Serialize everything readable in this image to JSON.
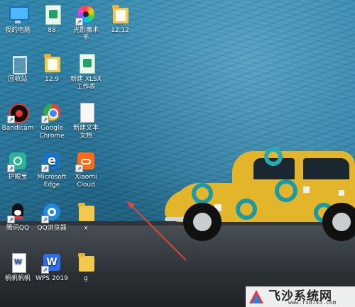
{
  "desktop": {
    "icons": [
      {
        "label": "我的电脑",
        "icon": "computer-icon"
      },
      {
        "label": "88",
        "icon": "spreadsheet-file-icon"
      },
      {
        "label": "光影魔术\n手",
        "icon": "color-wheel-icon"
      },
      {
        "label": "12.12",
        "icon": "folder-icon"
      },
      {
        "label": "回收站",
        "icon": "recycle-bin-icon"
      },
      {
        "label": "12.9",
        "icon": "folder-icon"
      },
      {
        "label": "新建 XLSX\n工作表",
        "icon": "spreadsheet-file-icon"
      },
      {
        "label": "Bandicam",
        "icon": "bandicam-icon"
      },
      {
        "label": "Google\nChrome",
        "icon": "chrome-icon"
      },
      {
        "label": "新建文本\n文档",
        "icon": "text-file-icon"
      },
      {
        "label": "护眼宝",
        "icon": "eye-protect-icon"
      },
      {
        "label": "Microsoft\nEdge",
        "icon": "edge-icon"
      },
      {
        "label": "Xiaomi\nCloud",
        "icon": "xiaomi-cloud-icon"
      },
      {
        "label": "腾讯QQ",
        "icon": "qq-icon"
      },
      {
        "label": "QQ浏览器",
        "icon": "qq-browser-icon"
      },
      {
        "label": "x",
        "icon": "folder-icon"
      },
      {
        "label": "帆帆帆帆",
        "icon": "word-doc-icon"
      },
      {
        "label": "WPS 2019",
        "icon": "wps-icon"
      },
      {
        "label": "g",
        "icon": "folder-icon"
      }
    ]
  },
  "watermark": {
    "title": "飞沙系统网",
    "url": "www.fs0745.com"
  },
  "colors": {
    "wall": "#2f86ad",
    "car": "#e2b52a",
    "car_ring": "#1b9aa6",
    "arrow": "#e0453a"
  }
}
